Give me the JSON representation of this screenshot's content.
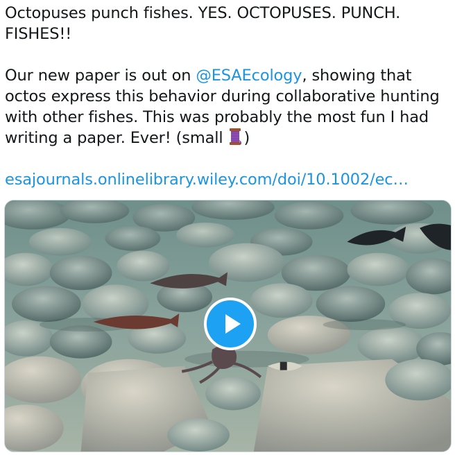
{
  "tweet": {
    "line1_text": "Octopuses punch fishes. YES. OCTOPUSES. PUNCH. FISHES!!",
    "para2_before_mention": "Our new paper is out on ",
    "mention": "@ESAEcology",
    "para2_after_mention": ", showing that octos express this behavior during collaborative hunting with other fishes. This was probably the most fun I had writing a paper. Ever! (small ",
    "spool_icon": "spool-of-thread-icon",
    "para2_end": ")",
    "link": "esajournals.onlinelibrary.wiley.com/doi/10.1002/ec…"
  },
  "media": {
    "type": "video",
    "play_icon": "play-icon",
    "accent_color": "#1da1f2"
  }
}
